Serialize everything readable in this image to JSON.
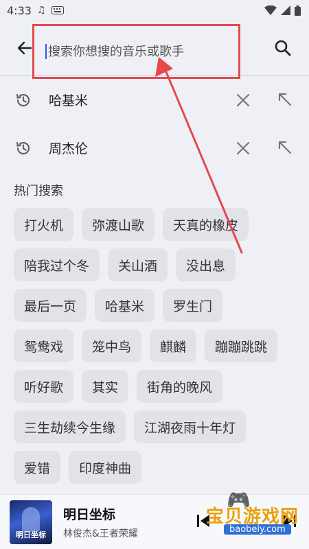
{
  "status_bar": {
    "time": "4:33"
  },
  "search": {
    "placeholder": "搜索你想搜的音乐或歌手",
    "value": ""
  },
  "history": [
    {
      "label": "哈基米"
    },
    {
      "label": "周杰伦"
    }
  ],
  "hot": {
    "title": "热门搜索",
    "rows": [
      [
        "打火机",
        "弥渡山歌",
        "天真的橡皮"
      ],
      [
        "陪我过个冬",
        "关山酒",
        "没出息"
      ],
      [
        "最后一页",
        "哈基米",
        "罗生门"
      ],
      [
        "鸳鸯戏",
        "笼中鸟",
        "麒麟",
        "蹦蹦跳跳"
      ],
      [
        "听好歌",
        "其实",
        "街角的晚风"
      ],
      [
        "三生劫续今生缘",
        "江湖夜雨十年灯"
      ],
      [
        "爱错",
        "印度神曲"
      ]
    ]
  },
  "player": {
    "cover_text": "明日坐标",
    "title": "明日坐标",
    "artist": "林俊杰&王者荣耀"
  },
  "watermark": {
    "text": "宝贝游戏网",
    "url": "baobeiy.com"
  },
  "colors": {
    "annotation": "#e5484d",
    "caret": "#2f54eb"
  }
}
